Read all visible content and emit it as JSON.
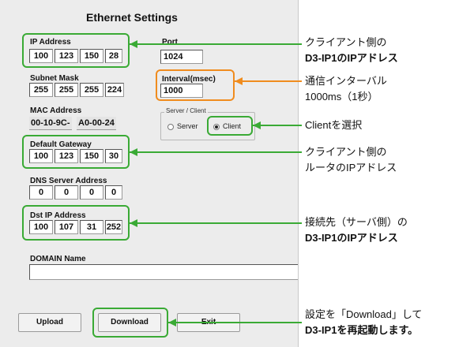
{
  "dialog": {
    "title": "Ethernet Settings",
    "ip_address": {
      "label": "IP Address",
      "octets": [
        "100",
        "123",
        "150",
        "28"
      ]
    },
    "subnet_mask": {
      "label": "Subnet  Mask",
      "octets": [
        "255",
        "255",
        "255",
        "224"
      ]
    },
    "mac_address": {
      "label": "MAC Address",
      "part1": "00-10-9C-",
      "part2": "A0-00-24"
    },
    "default_gateway": {
      "label": "Default Gateway",
      "octets": [
        "100",
        "123",
        "150",
        "30"
      ]
    },
    "dns_server": {
      "label": "DNS Server Address",
      "octets": [
        "0",
        "0",
        "0",
        "0"
      ]
    },
    "dst_ip": {
      "label": "Dst IP Address",
      "octets": [
        "100",
        "107",
        "31",
        "252"
      ]
    },
    "port": {
      "label": "Port",
      "value": "1024"
    },
    "interval": {
      "label": "Interval(msec)",
      "value": "1000"
    },
    "server_client": {
      "title": "Server / Client",
      "server_label": "Server",
      "client_label": "Client",
      "selected": "Client"
    },
    "domain": {
      "label": "DOMAIN Name",
      "value": ""
    },
    "buttons": {
      "upload": "Upload",
      "download": "Download",
      "exit": "Exit"
    }
  },
  "annotations": {
    "ip": {
      "line1": "クライアント側の",
      "line2": "D3-IP1のIPアドレス"
    },
    "interval": {
      "line1": "通信インターバル",
      "line2": "1000ms（1秒）"
    },
    "client": {
      "line1": "Clientを選択"
    },
    "gateway": {
      "line1": "クライアント側の",
      "line2": "ルータのIPアドレス"
    },
    "dst": {
      "line1": "接続先（サーバ側）の",
      "line2": "D3-IP1のIPアドレス"
    },
    "download": {
      "line1": "設定を「Download」して",
      "line2": "D3-IP1を再起動します。"
    }
  },
  "colors": {
    "green": "#3aaa35",
    "orange": "#f08c1e",
    "dialog_bg": "#ececec"
  }
}
